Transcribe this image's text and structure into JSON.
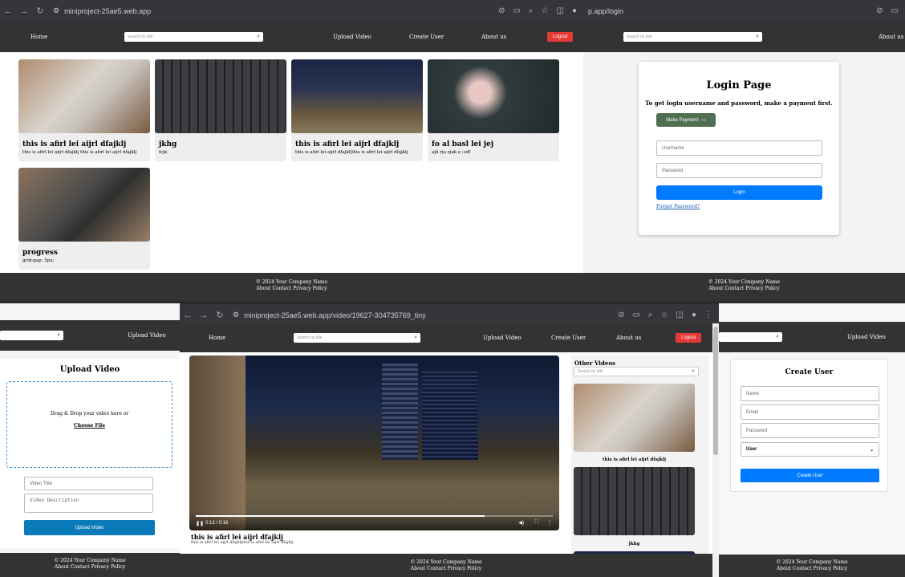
{
  "chrome_main": {
    "url": "miniproject-25ae5.web.app"
  },
  "chrome_login": {
    "url": "p.app/login"
  },
  "chrome_video": {
    "url": "miniproject-25ae5.web.app/video/19627-304735769_tiny"
  },
  "nav": {
    "home": "Home",
    "upload": "Upload Video",
    "create": "Create User",
    "about": "About us",
    "logout": "Logout",
    "search_placeholder": "Search by title"
  },
  "videos": [
    {
      "title": "this is afirl lei aijrl dfajklj",
      "desc": "this is afirl lei aijrl dfajklj this is afirl lei aijrl dfajklj"
    },
    {
      "title": "jkhg",
      "desc": "fcjk"
    },
    {
      "title": "this is afirl lei aijrl dfajklj",
      "desc": "this is afirl lei aijrl dfajkljthis is afirl lei aijrl dfajklj"
    },
    {
      "title": "fo al basl lei jej",
      "desc": "ajli rja ejak e ;sdf"
    },
    {
      "title": "progress",
      "desc": "grid-gap: 5px;"
    }
  ],
  "footer": {
    "copy": "© 2024 Your Company Name",
    "about": "About",
    "contact": "Contact",
    "privacy": "Privacy Policy"
  },
  "login": {
    "title": "Login Page",
    "note": "To get login username and password, make a payment first.",
    "pay": "Make Payment",
    "username": "Username",
    "password": "Password",
    "button": "Login",
    "forgot": "Forgot Password?"
  },
  "upload": {
    "title": "Upload Video",
    "drop": "Drag & Drop your video here or",
    "choose": "Choose File",
    "vtitle": "Video Title",
    "vdesc": "Video Description",
    "button": "Upload Video"
  },
  "player": {
    "time": "0:13 / 0:16",
    "progress": 0.81,
    "title": "this is afirl lei aijrl dfajklj",
    "desc": "this is afirl lei aijrl dfajkljthis is afirl lei aijrl dfajklj",
    "other": "Other Videos",
    "other_items": [
      "this is afirl lei aijrl dfajklj",
      "jkhg"
    ]
  },
  "create": {
    "title": "Create User",
    "name": "Name",
    "email": "Email",
    "password": "Password",
    "role": "User",
    "button": "Create User"
  }
}
